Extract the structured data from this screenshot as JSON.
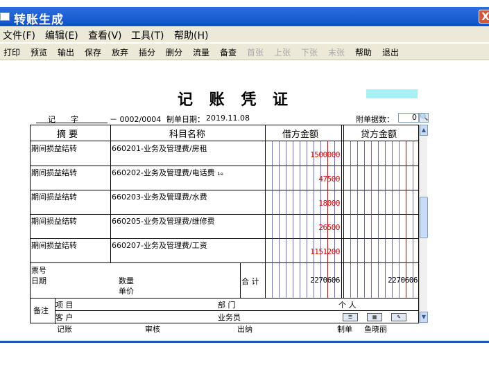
{
  "window": {
    "title": "转账生成",
    "close_glyph": "X"
  },
  "menu": [
    {
      "label": "文件(F)"
    },
    {
      "label": "编辑(E)"
    },
    {
      "label": "查看(V)"
    },
    {
      "label": "工具(T)"
    },
    {
      "label": "帮助(H)"
    }
  ],
  "toolbar": [
    {
      "label": "打印",
      "enabled": true
    },
    {
      "label": "预览",
      "enabled": true
    },
    {
      "label": "输出",
      "enabled": true
    },
    {
      "label": "保存",
      "enabled": true
    },
    {
      "label": "放弃",
      "enabled": true
    },
    {
      "label": "插分",
      "enabled": true
    },
    {
      "label": "删分",
      "enabled": true
    },
    {
      "label": "流量",
      "enabled": true
    },
    {
      "label": "备查",
      "enabled": true
    },
    {
      "label": "首张",
      "enabled": false
    },
    {
      "label": "上张",
      "enabled": false
    },
    {
      "label": "下张",
      "enabled": false
    },
    {
      "label": "末张",
      "enabled": false
    },
    {
      "label": "帮助",
      "enabled": true
    },
    {
      "label": "退出",
      "enabled": true
    }
  ],
  "voucher": {
    "title": "记 账 凭 证",
    "type_label": "记",
    "zi_label": "字",
    "number": "－ 0002/0004",
    "date_label": "制单日期：",
    "date": "2019.11.08",
    "attach_label": "附单据数：",
    "attach_count": "0"
  },
  "columns": {
    "summary": "摘 要",
    "account": "科目名称",
    "debit": "借方金额",
    "credit": "贷方金额"
  },
  "rows": [
    {
      "summary": "期间损益结转",
      "account": "660201-业务及管理费/房租",
      "debit": "1500000"
    },
    {
      "summary": "期间损益结转",
      "account": "660202-业务及管理费/电话费 ₁ₑ",
      "debit": "47500"
    },
    {
      "summary": "期间损益结转",
      "account": "660203-业务及管理费/水费",
      "debit": "18000"
    },
    {
      "summary": "期间损益结转",
      "account": "660205-业务及管理费/维修费",
      "debit": "26500"
    },
    {
      "summary": "期间损益结转",
      "account": "660207-业务及管理费/工资",
      "debit": "1151200"
    }
  ],
  "totals": {
    "ticket_no_label": "票号",
    "date_label": "日期",
    "qty_label": "数量",
    "price_label": "单价",
    "total_label": "合 计",
    "debit_total": "2270606",
    "credit_total": "2270606"
  },
  "remarks": {
    "label": "备注",
    "project_label": "项 目",
    "dept_label": "部 门",
    "person_label": "个 人",
    "customer_label": "客 户",
    "salesman_label": "业务员"
  },
  "signoff": {
    "bookkeeping": "记账",
    "audit": "审核",
    "cashier": "出纳",
    "maker_label": "制单",
    "maker_name": "鱼晓丽"
  },
  "colors": {
    "title_bar": "#1e5bd0",
    "amount_red": "#e00000",
    "accent_cyan": "#a8f0f4"
  }
}
